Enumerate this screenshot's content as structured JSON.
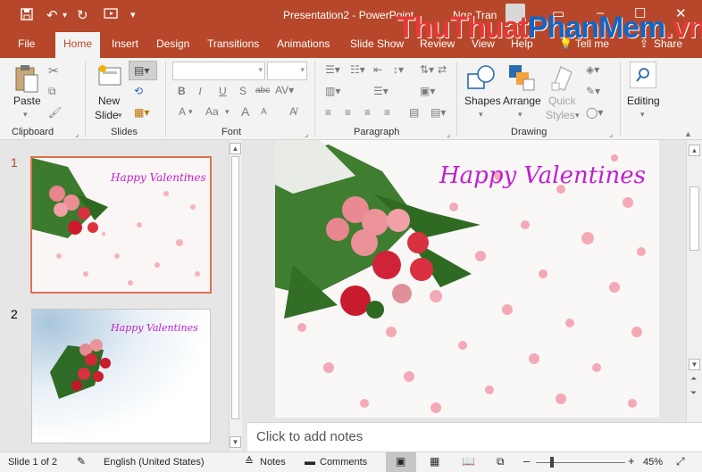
{
  "titlebar": {
    "title": "Presentation2 - PowerPoint",
    "user": "Nga Tran",
    "watermark_part1": "ThuThuat",
    "watermark_part2": "PhanMem",
    "watermark_part3": ".vn"
  },
  "tabs": [
    "File",
    "Home",
    "Insert",
    "Design",
    "Transitions",
    "Animations",
    "Slide Show",
    "Review",
    "View",
    "Help",
    "Tell me",
    "Share"
  ],
  "active_tab": "Home",
  "ribbon": {
    "clipboard": {
      "paste": "Paste",
      "label": "Clipboard"
    },
    "slides": {
      "new_slide_line1": "New",
      "new_slide_line2": "Slide",
      "label": "Slides"
    },
    "font": {
      "label": "Font",
      "bold": "B",
      "italic": "I",
      "underline": "U",
      "shadow": "S",
      "strike": "abc",
      "font_color": "A",
      "font_size_big": "A",
      "font_size_small": "A",
      "change_case": "Aa"
    },
    "paragraph": {
      "label": "Paragraph"
    },
    "drawing": {
      "shapes": "Shapes",
      "arrange": "Arrange",
      "quick_styles_line1": "Quick",
      "quick_styles_line2": "Styles",
      "label": "Drawing"
    },
    "editing": {
      "label": "Editing"
    }
  },
  "slides": [
    {
      "number": "1",
      "title": "Happy Valentines",
      "selected": true
    },
    {
      "number": "2",
      "title": "Happy Valentines",
      "selected": false
    }
  ],
  "main_slide": {
    "title": "Happy Valentines"
  },
  "notes_placeholder": "Click to add notes",
  "status": {
    "slide": "Slide 1 of 2",
    "language": "English (United States)",
    "notes": "Notes",
    "comments": "Comments",
    "zoom": "45%"
  },
  "colors": {
    "accent": "#b7472a",
    "title_text": "#c020d0"
  }
}
